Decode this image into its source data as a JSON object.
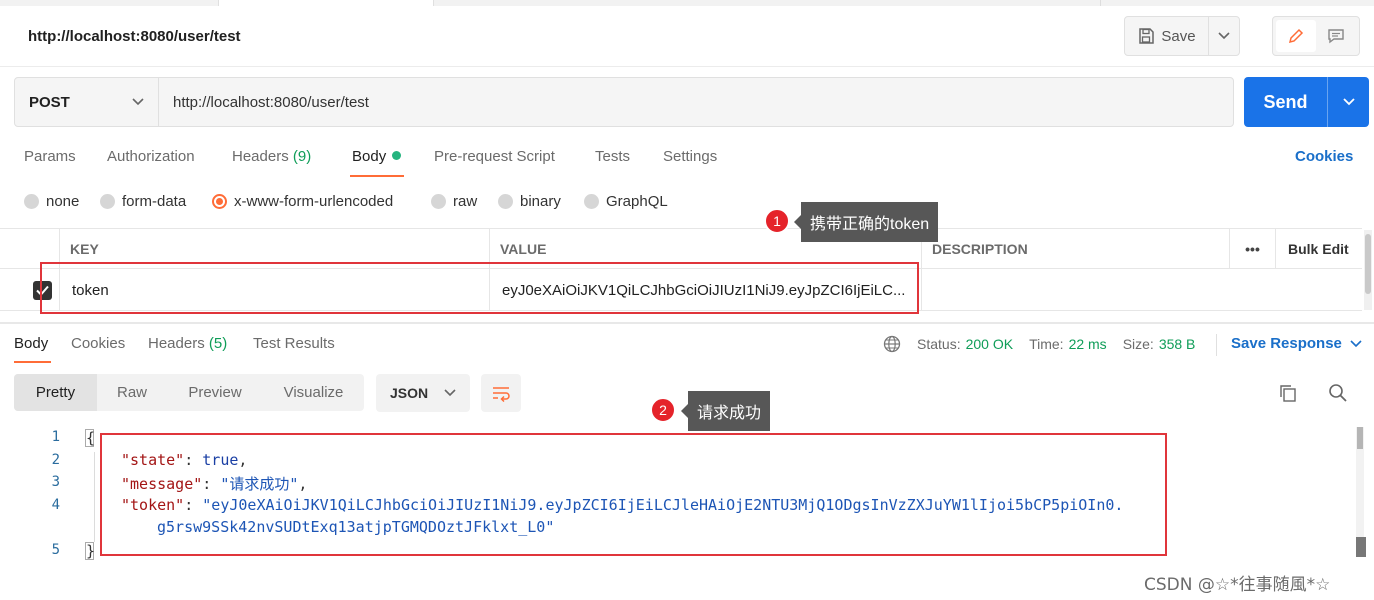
{
  "header": {
    "url_title": "http://localhost:8080/user/test",
    "save_label": "Save"
  },
  "request": {
    "method": "POST",
    "url": "http://localhost:8080/user/test",
    "send_label": "Send"
  },
  "request_tabs": {
    "params": "Params",
    "authorization": "Authorization",
    "headers": "Headers",
    "headers_count": "(9)",
    "body": "Body",
    "prerequest": "Pre-request Script",
    "tests": "Tests",
    "settings": "Settings",
    "cookies": "Cookies"
  },
  "body_types": {
    "none": "none",
    "form_data": "form-data",
    "urlencoded": "x-www-form-urlencoded",
    "raw": "raw",
    "binary": "binary",
    "graphql": "GraphQL",
    "selected": "x-www-form-urlencoded"
  },
  "annotations": {
    "one_num": "1",
    "one_text": "携带正确的token",
    "two_num": "2",
    "two_text": "请求成功"
  },
  "params_table": {
    "headers": {
      "key": "KEY",
      "value": "VALUE",
      "description": "DESCRIPTION",
      "more": "•••",
      "bulk_edit": "Bulk Edit"
    },
    "row": {
      "checked": true,
      "key": "token",
      "value": "eyJ0eXAiOiJKV1QiLCJhbGciOiJIUzI1NiJ9.eyJpZCI6IjEiLC...",
      "description": ""
    }
  },
  "response": {
    "tabs": {
      "body": "Body",
      "cookies": "Cookies",
      "headers": "Headers",
      "headers_count": "(5)",
      "test_results": "Test Results"
    },
    "status_label": "Status:",
    "status_value": "200 OK",
    "time_label": "Time:",
    "time_value": "22 ms",
    "size_label": "Size:",
    "size_value": "358 B",
    "save_response": "Save Response",
    "formats": {
      "pretty": "Pretty",
      "raw": "Raw",
      "preview": "Preview",
      "visualize": "Visualize"
    },
    "language": "JSON",
    "line_numbers": [
      "1",
      "2",
      "3",
      "4",
      "5"
    ],
    "json": {
      "open": "{",
      "close": "}",
      "state_key": "\"state\"",
      "state_value": "true",
      "message_key": "\"message\"",
      "message_value": "\"请求成功\"",
      "token_key": "\"token\"",
      "token_value_line1": "\"eyJ0eXAiOiJKV1QiLCJhbGciOiJIUzI1NiJ9.eyJpZCI6IjEiLCJleHAiOjE2NTU3MjQ1ODgsInVzZXJuYW1lIjoi5bCP5piOIn0.",
      "token_value_line2": "g5rsw9SSk42nvSUDtExq13atjpTGMQDOztJFklxt_L0\""
    }
  },
  "watermark": "CSDN @☆*往事随風*☆"
}
